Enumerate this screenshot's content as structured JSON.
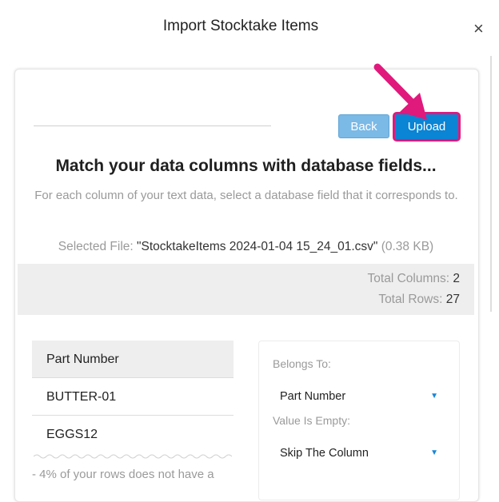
{
  "header": {
    "title": "Import Stocktake Items",
    "close_glyph": "×"
  },
  "toolbar": {
    "back_label": "Back",
    "upload_label": "Upload"
  },
  "mapping": {
    "title": "Match your data columns with database fields...",
    "description": "For each column of your text data, select a database field that it corresponds to.",
    "selected_file_label": "Selected File:",
    "selected_file_name": "\"StocktakeItems 2024-01-04 15_24_01.csv\"",
    "selected_file_size": "(0.38 KB)"
  },
  "stats": {
    "total_columns_label": "Total Columns:",
    "total_columns_value": "2",
    "total_rows_label": "Total Rows:",
    "total_rows_value": "27"
  },
  "column": {
    "header": "Part Number",
    "rows": [
      "BUTTER-01",
      "EGGS12"
    ],
    "warning": "- 4% of your rows does not have a"
  },
  "field_mapping": {
    "belongs_to_label": "Belongs To:",
    "belongs_to_value": "Part Number",
    "value_empty_label": "Value Is Empty:",
    "value_empty_value": "Skip The Column"
  },
  "colors": {
    "accent": "#0a84d4",
    "back_button": "#7bb9e6",
    "highlight": "#e0197d"
  }
}
